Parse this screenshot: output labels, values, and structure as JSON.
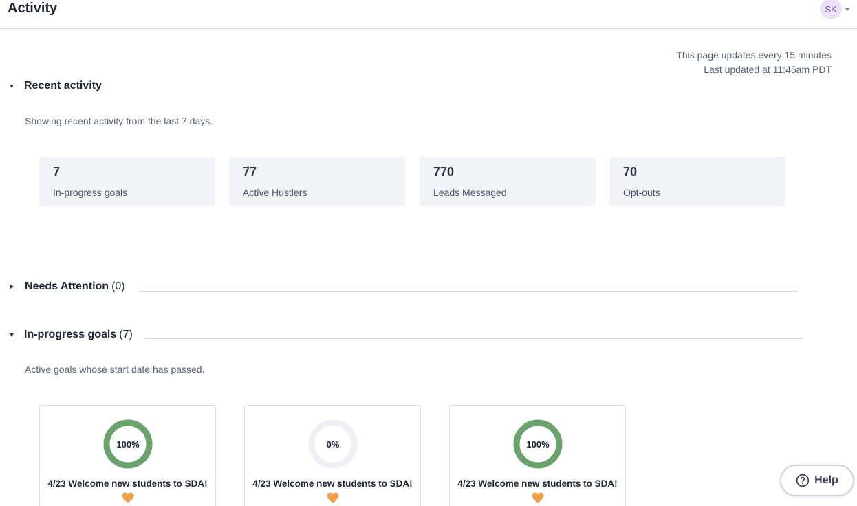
{
  "header": {
    "title": "Activity",
    "user_initials": "SK"
  },
  "update_note": {
    "line1": "This page updates every 15 minutes",
    "line2": "Last updated at 11:45am PDT"
  },
  "recent_activity": {
    "title": "Recent activity",
    "expanded": true,
    "description": "Showing recent activity from the last 7 days.",
    "stats": [
      {
        "value": "7",
        "label": "In-progress goals"
      },
      {
        "value": "77",
        "label": "Active Hustlers"
      },
      {
        "value": "770",
        "label": "Leads Messaged"
      },
      {
        "value": "70",
        "label": "Opt-outs"
      }
    ]
  },
  "needs_attention": {
    "title": "Needs Attention",
    "count": "(0)",
    "expanded": false
  },
  "in_progress_goals": {
    "title": "In-progress goals",
    "count": "(7)",
    "expanded": true,
    "description": "Active goals whose start date has passed.",
    "goals": [
      {
        "progress_label": "100%",
        "progress": 1.0,
        "title": "4/23 Welcome new students to SDA!",
        "icon": "orange-heart-icon"
      },
      {
        "progress_label": "0%",
        "progress": 0.0,
        "title": "4/23 Welcome new students to SDA!",
        "icon": "orange-heart-icon"
      },
      {
        "progress_label": "100%",
        "progress": 1.0,
        "title": "4/23 Welcome new students to SDA!",
        "icon": "orange-heart-icon"
      }
    ]
  },
  "help": {
    "label": "Help",
    "icon": "question-circle-icon"
  },
  "colors": {
    "progress_ring": "#6aa36c",
    "ring_track": "#eef0f5",
    "heart": "#f0a04a",
    "avatar_bg": "#ece2f7"
  }
}
